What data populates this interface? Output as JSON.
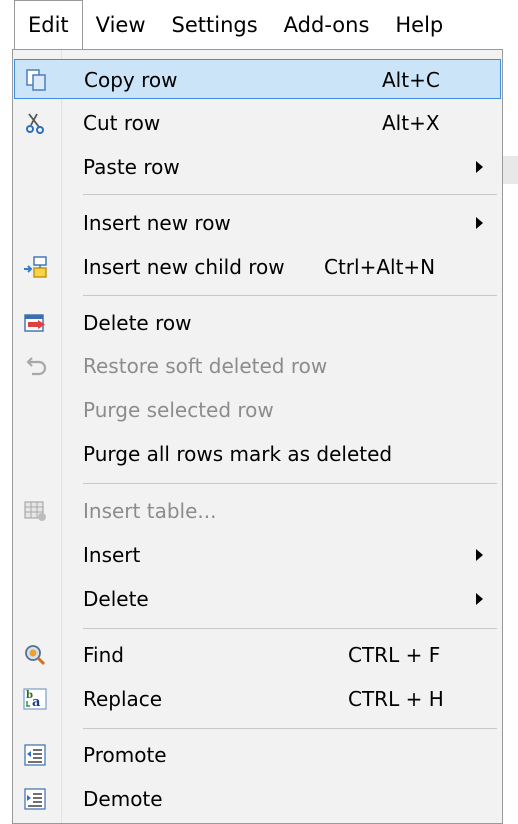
{
  "menubar": {
    "items": [
      "Edit",
      "View",
      "Settings",
      "Add-ons",
      "Help"
    ]
  },
  "menu": {
    "copy_row": {
      "label": "Copy row",
      "shortcut": "Alt+C"
    },
    "cut_row": {
      "label": "Cut row",
      "shortcut": "Alt+X"
    },
    "paste_row": {
      "label": "Paste row"
    },
    "insert_new_row": {
      "label": "Insert new row"
    },
    "insert_child_row": {
      "label": "Insert new child row",
      "shortcut": "Ctrl+Alt+N"
    },
    "delete_row": {
      "label": "Delete row"
    },
    "restore_soft_deleted": {
      "label": "Restore soft deleted row"
    },
    "purge_selected": {
      "label": "Purge selected row"
    },
    "purge_all": {
      "label": "Purge all rows mark as deleted"
    },
    "insert_table": {
      "label": "Insert table..."
    },
    "insert": {
      "label": "Insert"
    },
    "delete": {
      "label": "Delete"
    },
    "find": {
      "label": "Find",
      "shortcut": "CTRL + F"
    },
    "replace": {
      "label": "Replace",
      "shortcut": "CTRL + H"
    },
    "promote": {
      "label": "Promote"
    },
    "demote": {
      "label": "Demote"
    }
  },
  "colors": {
    "highlight": "#cbe4f8",
    "highlight_border": "#3d8fe0",
    "disabled_text": "#8c8c8c",
    "menu_bg": "#f2f2f2"
  }
}
